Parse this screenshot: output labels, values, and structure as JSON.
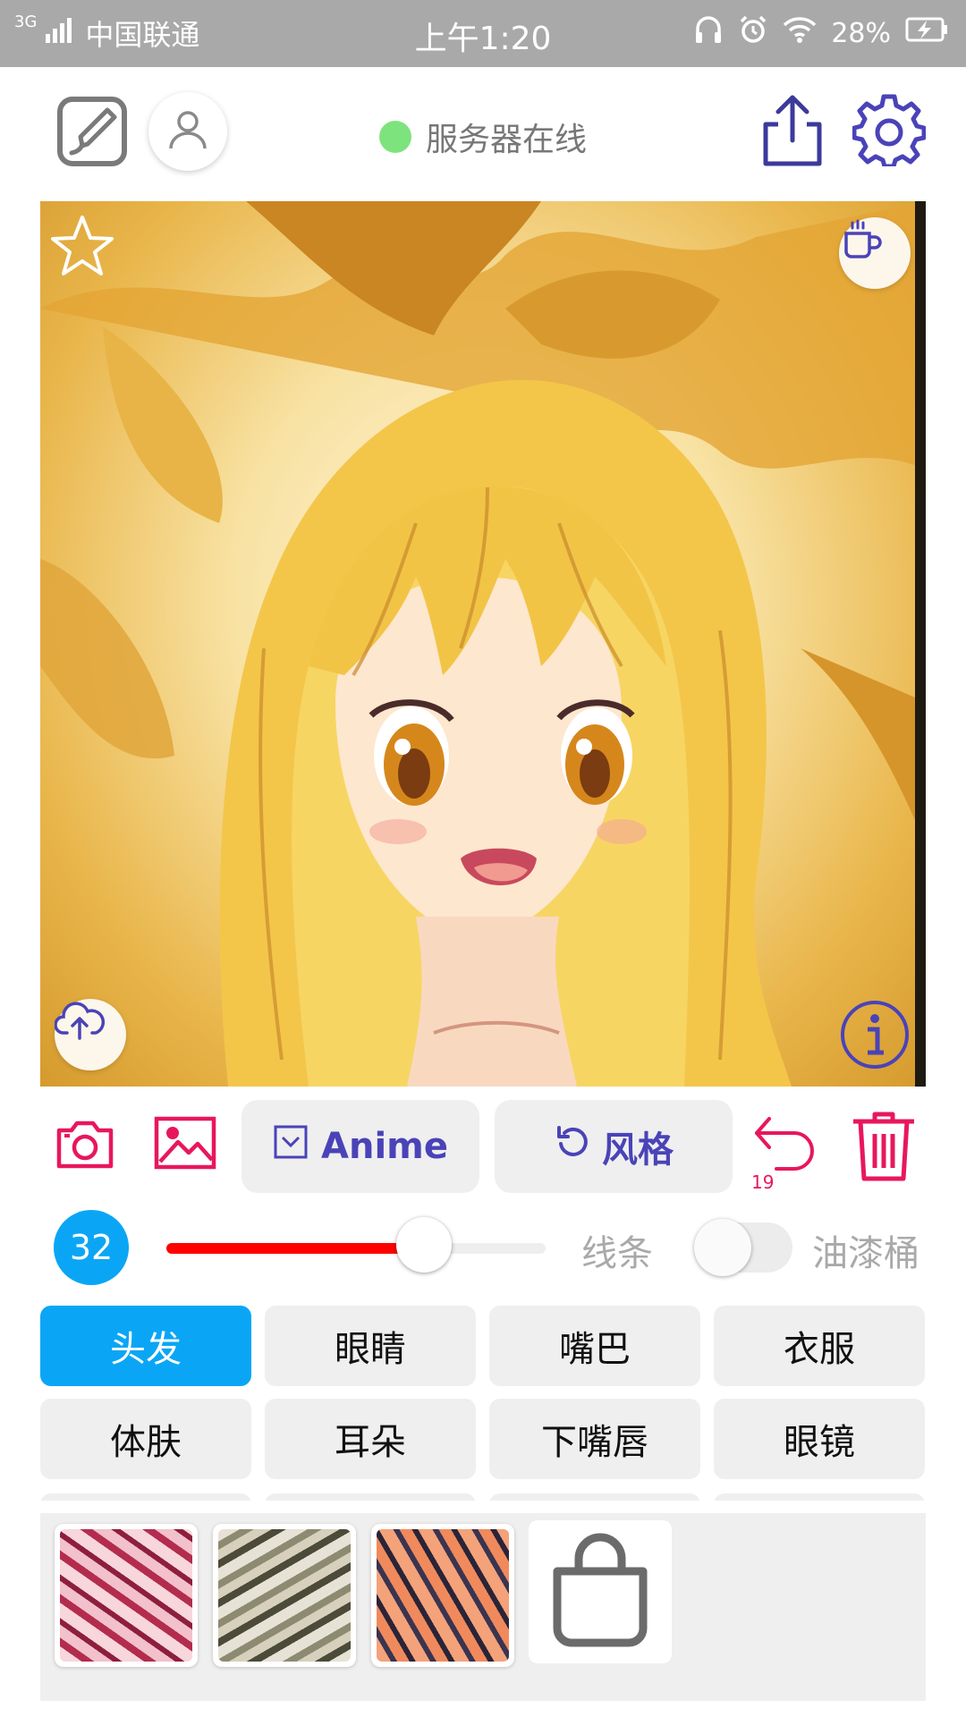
{
  "status_bar": {
    "network": "3G",
    "carrier": "中国联通",
    "time": "上午1:20",
    "battery": "28%"
  },
  "header": {
    "server_status": "服务器在线",
    "icons": [
      "brush-icon",
      "user-icon",
      "share-icon",
      "settings-icon"
    ]
  },
  "canvas": {
    "icons": [
      "star-icon",
      "coffee-icon",
      "cloud-upload-icon",
      "info-icon"
    ]
  },
  "toolbar": {
    "model_label": "Anime",
    "style_label": "风格",
    "undo_count": "19",
    "icons": [
      "camera-icon",
      "image-icon",
      "undo-icon",
      "trash-icon"
    ],
    "accent_color": "#e8175d",
    "primary_color": "#4a43b8"
  },
  "slider": {
    "brush_size": "32",
    "fill_fraction": 0.68,
    "line_label": "线条",
    "bucket_label": "油漆桶",
    "bucket_enabled": false
  },
  "parts": [
    {
      "label": "头发",
      "active": true
    },
    {
      "label": "眼睛",
      "active": false
    },
    {
      "label": "嘴巴",
      "active": false
    },
    {
      "label": "衣服",
      "active": false
    },
    {
      "label": "体肤",
      "active": false
    },
    {
      "label": "耳朵",
      "active": false
    },
    {
      "label": "下嘴唇",
      "active": false
    },
    {
      "label": "眼镜",
      "active": false
    }
  ],
  "swatches": [
    {
      "name": "red-texture",
      "colors": [
        "#f7d6dc",
        "#b32c4e"
      ]
    },
    {
      "name": "olive-texture",
      "colors": [
        "#e7e2d6",
        "#5c5a45"
      ]
    },
    {
      "name": "orange-texture",
      "colors": [
        "#f4a27a",
        "#3a3450"
      ]
    },
    {
      "name": "store-bag",
      "icon": "bag-icon"
    }
  ]
}
